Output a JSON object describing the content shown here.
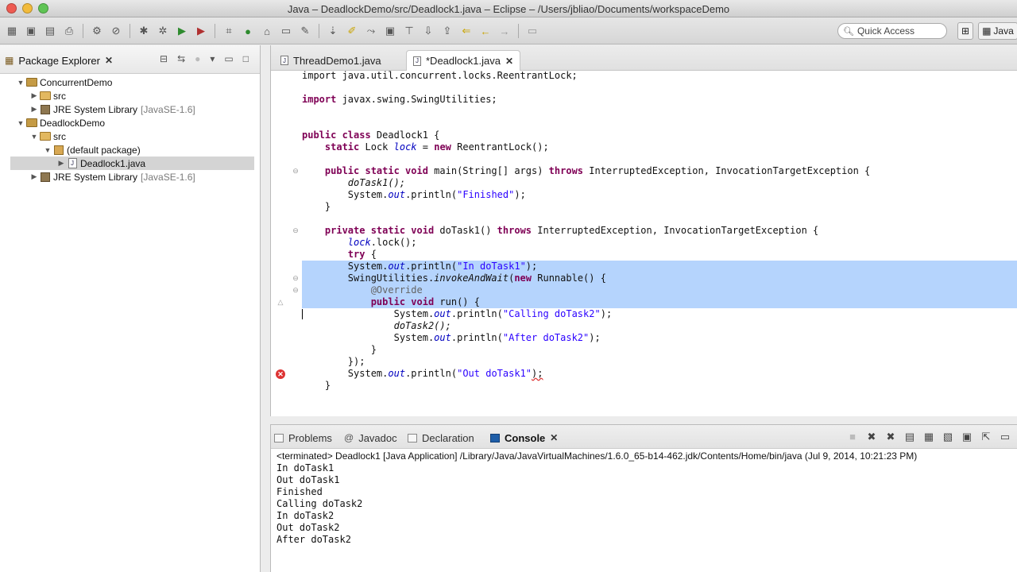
{
  "window": {
    "title": "Java – DeadlockDemo/src/Deadlock1.java – Eclipse – /Users/jbliao/Documents/workspaceDemo"
  },
  "toolbar": {
    "quick_access_placeholder": "Quick Access",
    "perspective_label": "Java"
  },
  "package_explorer": {
    "title": "Package Explorer",
    "tree": [
      {
        "label": "ConcurrentDemo",
        "level": 0,
        "expanded": true,
        "icon": "project-icon"
      },
      {
        "label": "src",
        "level": 1,
        "expanded": false,
        "icon": "source-folder-icon"
      },
      {
        "label": "JRE System Library",
        "suffix": "[JavaSE-1.6]",
        "level": 1,
        "expanded": false,
        "icon": "library-icon"
      },
      {
        "label": "DeadlockDemo",
        "level": 0,
        "expanded": true,
        "icon": "project-icon"
      },
      {
        "label": "src",
        "level": 1,
        "expanded": true,
        "icon": "source-folder-icon"
      },
      {
        "label": "(default package)",
        "level": 2,
        "expanded": true,
        "icon": "package-icon"
      },
      {
        "label": "Deadlock1.java",
        "level": 3,
        "expanded": false,
        "icon": "java-file-icon",
        "selected": true
      },
      {
        "label": "JRE System Library",
        "suffix": "[JavaSE-1.6]",
        "level": 1,
        "expanded": false,
        "icon": "library-icon"
      }
    ]
  },
  "editor": {
    "tabs": [
      {
        "label": "ThreadDemo1.java",
        "active": false
      },
      {
        "label": "*Deadlock1.java",
        "active": true
      }
    ],
    "code": {
      "l1": "import java.util.concurrent.locks.ReentrantLock;",
      "l2_kw": "import",
      "l2": " javax.swing.SwingUtilities;",
      "l3_kw1": "public class",
      "l3": " Deadlock1 {",
      "l4_kw": "static",
      "l4_a": " Lock ",
      "l4_fld": "lock",
      "l4_b": " = ",
      "l4_kw2": "new",
      "l4_c": " ReentrantLock();",
      "l5_kw": "public static void",
      "l5_a": " main(String[] args) ",
      "l5_kw2": "throws",
      "l5_b": " InterruptedException, InvocationTargetException {",
      "l6": "doTask1();",
      "l7_a": "System.",
      "l7_fld": "out",
      "l7_b": ".println(",
      "l7_str": "\"Finished\"",
      "l7_c": ");",
      "l8": "}",
      "l9_kw": "private static void",
      "l9_a": " doTask1() ",
      "l9_kw2": "throws",
      "l9_b": " InterruptedException, InvocationTargetException {",
      "l10_fld": "lock",
      "l10_a": ".lock();",
      "l11_kw": "try",
      "l11_a": " {",
      "l12_a": "System.",
      "l12_fld": "out",
      "l12_b": ".println(",
      "l12_str": "\"In doTask1\"",
      "l12_c": ");",
      "l13_a": "SwingUtilities.",
      "l13_it": "invokeAndWait",
      "l13_b": "(",
      "l13_kw": "new",
      "l13_c": " Runnable() {",
      "l14_ann": "@Override",
      "l15_kw": "public void",
      "l15_a": " run() {",
      "l16_a": "System.",
      "l16_fld": "out",
      "l16_b": ".println(",
      "l16_str": "\"Calling doTask2\"",
      "l16_c": ");",
      "l17": "doTask2();",
      "l18_a": "System.",
      "l18_fld": "out",
      "l18_b": ".println(",
      "l18_str": "\"After doTask2\"",
      "l18_c": ");",
      "l19": "}",
      "l20": "});",
      "l21_a": "System.",
      "l21_fld": "out",
      "l21_b": ".println(",
      "l21_str": "\"Out doTask1\"",
      "l21_c": ");",
      "l22": "}"
    }
  },
  "console_view": {
    "tabs": [
      {
        "label": "Problems",
        "active": false,
        "icon": "problems-icon"
      },
      {
        "label": "Javadoc",
        "active": false,
        "icon": "javadoc-icon"
      },
      {
        "label": "Declaration",
        "active": false,
        "icon": "declaration-icon"
      },
      {
        "label": "Console",
        "active": true,
        "icon": "console-icon"
      }
    ],
    "status": "<terminated> Deadlock1 [Java Application] /Library/Java/JavaVirtualMachines/1.6.0_65-b14-462.jdk/Contents/Home/bin/java (Jul 9, 2014, 10:21:23 PM)",
    "output": [
      "In doTask1",
      "Out doTask1",
      "Finished",
      "Calling doTask2",
      "In doTask2",
      "Out doTask2",
      "After doTask2"
    ]
  },
  "colors": {
    "keyword": "#7f0055",
    "string": "#2a00ff",
    "field": "#0000c0",
    "selection": "#b5d4fd",
    "error": "#dd3333"
  }
}
